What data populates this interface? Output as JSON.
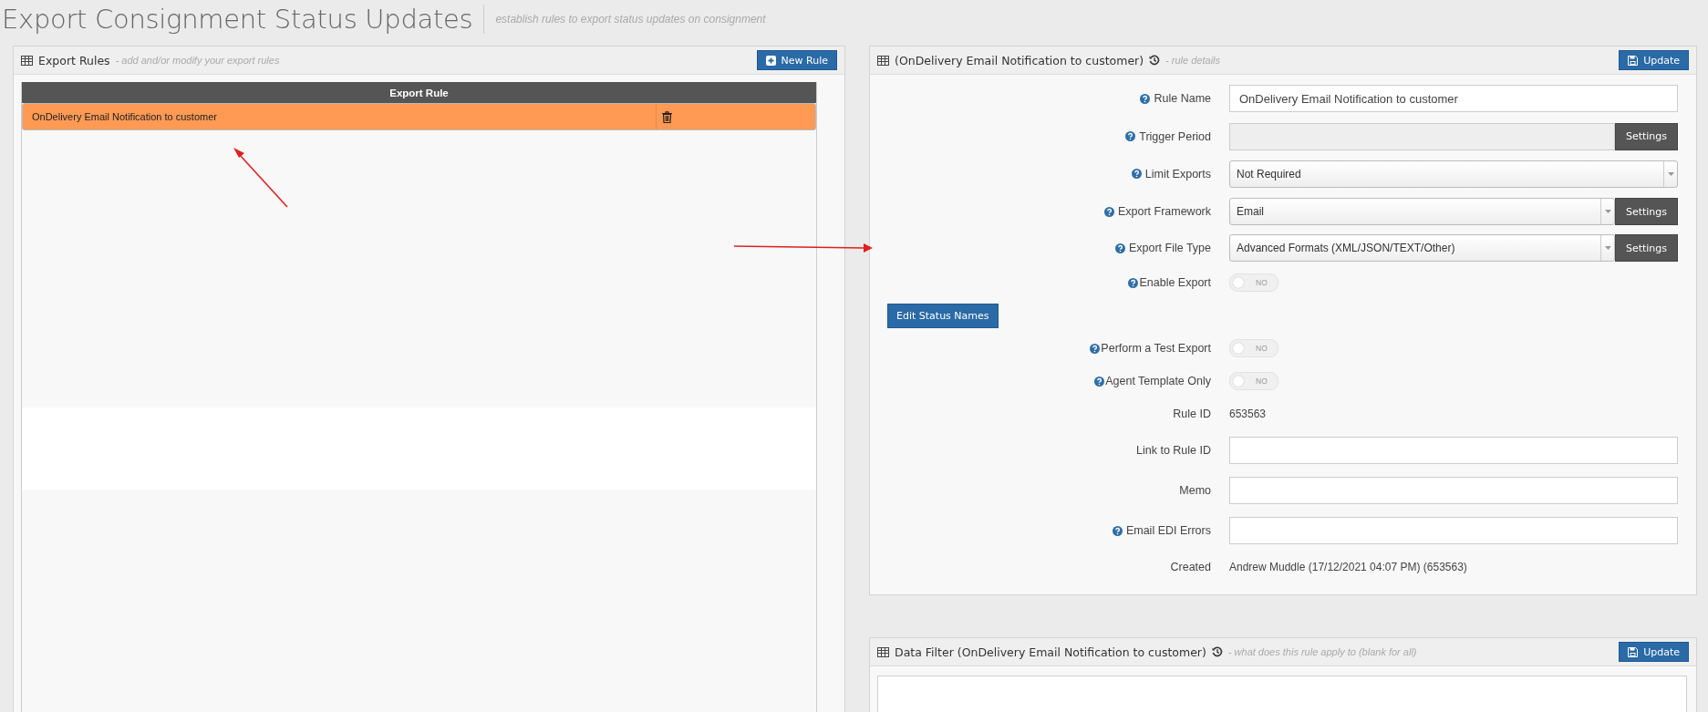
{
  "page": {
    "title": "Export Consignment Status Updates",
    "subtitle": "establish rules to export status updates on consignment"
  },
  "export_rules": {
    "title": "Export Rules",
    "hint": "- add and/or modify your export rules",
    "button": "New Rule",
    "table": {
      "columns": [
        "Export Rule"
      ],
      "rows": [
        {
          "name": "OnDelivery Email Notification to customer",
          "selected": true
        }
      ]
    }
  },
  "rule_details": {
    "title": "(OnDelivery Email Notification to customer)",
    "hint": "- rule details",
    "button": "Update",
    "fields": [
      {
        "kind": "text",
        "label": "Rule Name",
        "help": true,
        "value": "OnDelivery Email Notification to customer"
      },
      {
        "kind": "settings",
        "label": "Trigger Period",
        "help": true,
        "button": "Settings"
      },
      {
        "kind": "select",
        "label": "Limit Exports",
        "help": true,
        "value": "Not Required"
      },
      {
        "kind": "select-settings",
        "label": "Export Framework",
        "help": true,
        "value": "Email",
        "button": "Settings"
      },
      {
        "kind": "select-settings",
        "label": "Export File Type",
        "help": true,
        "value": "Advanced Formats (XML/JSON/TEXT/Other)",
        "button": "Settings"
      },
      {
        "kind": "toggle",
        "label": "Enable Export",
        "help": true,
        "on": false,
        "state_text": "NO"
      },
      {
        "kind": "button",
        "button": "Edit Status Names"
      },
      {
        "kind": "toggle",
        "label": "Perform a Test Export",
        "help": true,
        "on": false,
        "state_text": "NO"
      },
      {
        "kind": "toggle",
        "label": "Agent Template Only",
        "help": true,
        "on": false,
        "state_text": "NO"
      },
      {
        "kind": "display",
        "label": "Rule ID",
        "help": false,
        "value": "653563"
      },
      {
        "kind": "text",
        "label": "Link to Rule ID",
        "help": false
      },
      {
        "kind": "text",
        "label": "Memo",
        "help": false
      },
      {
        "kind": "text",
        "label": "Email EDI Errors",
        "help": true
      },
      {
        "kind": "display",
        "label": "Created",
        "help": false,
        "value": "Andrew Muddle (17/12/2021 04:07 PM) (653563)"
      }
    ]
  },
  "data_filter": {
    "title": "Data Filter (OnDelivery Email Notification to customer)",
    "hint": "- what does this rule apply to (blank for all)",
    "button": "Update"
  }
}
